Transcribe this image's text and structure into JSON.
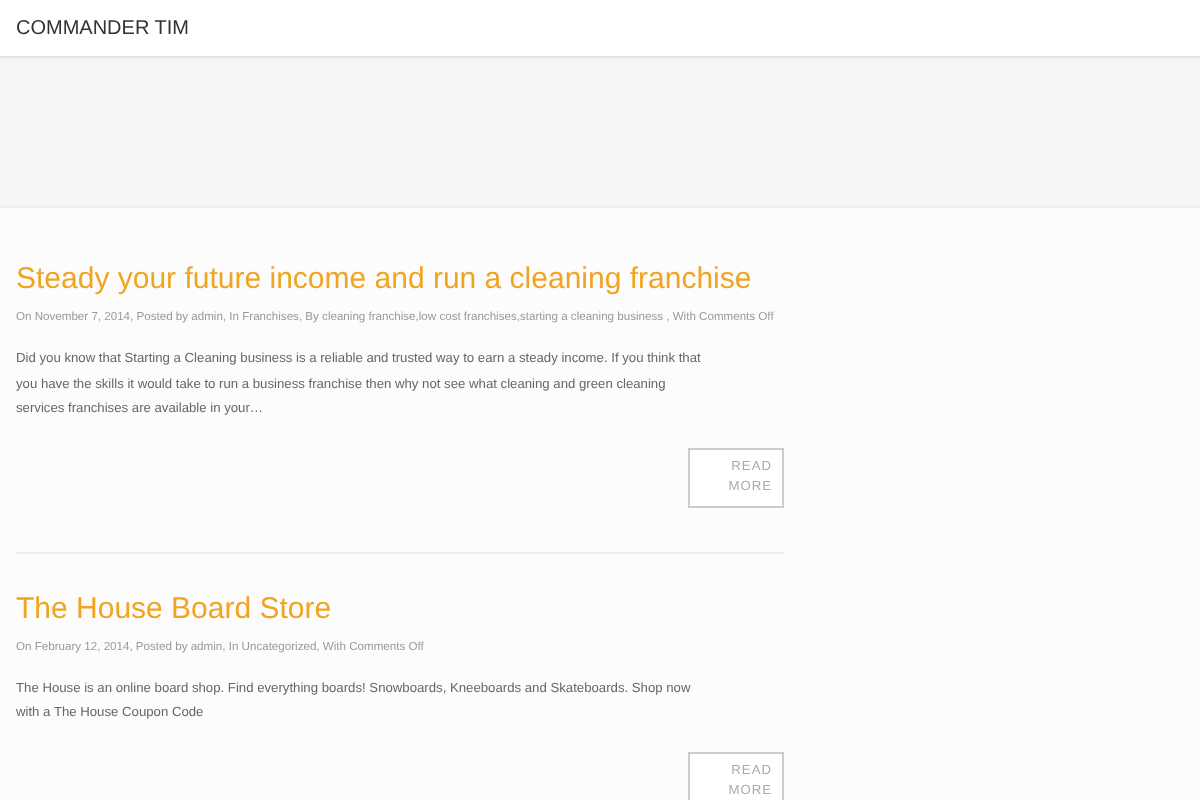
{
  "site": {
    "title": "COMMANDER TIM"
  },
  "posts": [
    {
      "title": "Steady your future income and run a cleaning franchise",
      "meta": "On November 7, 2014, Posted by admin, In Franchises, By cleaning franchise,low cost franchises,starting a cleaning business , With Comments Off",
      "excerpt": "Did you know that Starting a Cleaning business is a reliable and trusted way to earn a steady income. If you think that you have the skills it would take to run a business franchise then why not see what cleaning and green cleaning services franchises are available in your…",
      "button": "READ MORE"
    },
    {
      "title": "The House Board Store",
      "meta": "On February 12, 2014, Posted by admin, In Uncategorized, With Comments Off",
      "excerpt": "The House is an online board shop. Find everything  boards! Snowboards, Kneeboards and Skateboards. Shop now with a The House Coupon Code",
      "button": "READ MORE"
    }
  ]
}
